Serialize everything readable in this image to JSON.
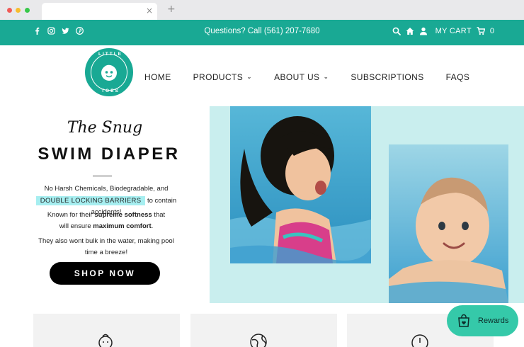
{
  "browser": {
    "new_tab_symbol": "+",
    "close_symbol": "×"
  },
  "topbar": {
    "social_icons": [
      "facebook-icon",
      "instagram-icon",
      "twitter-icon",
      "pinterest-icon"
    ],
    "phone": "Questions? Call (561) 207-7680",
    "cart_label": "MY CART",
    "cart_count": "0",
    "bg_color": "#19a994"
  },
  "logo": {
    "top_text": "LITTLE",
    "bottom_text": "TOES"
  },
  "nav": {
    "items": [
      {
        "label": "HOME",
        "has_dropdown": false
      },
      {
        "label": "PRODUCTS",
        "has_dropdown": true
      },
      {
        "label": "ABOUT US",
        "has_dropdown": true
      },
      {
        "label": "SUBSCRIPTIONS",
        "has_dropdown": false
      },
      {
        "label": "FAQS",
        "has_dropdown": false
      }
    ],
    "chevron": "⌄"
  },
  "hero": {
    "script_title": "The Snug",
    "title": "SWIM DIAPER",
    "line1": "No Harsh Chemicals, Biodegradable, and",
    "highlight": "DOUBLE LOCKING BARRIERS",
    "line2_after": " to contain accidents!",
    "line3_pre": "Known for their ",
    "line3_bold": "supreme softness",
    "line3_post": " that",
    "line4_pre": "will ensure ",
    "line4_bold": "maximum comfort",
    "line4_post": ".",
    "line5": "They also wont bulk in the water, making pool",
    "line6": "time a breeze!",
    "cta": "SHOP NOW",
    "panel_color": "#c9eeee"
  },
  "rewards": {
    "label": "Rewards",
    "color": "#35c9a9"
  }
}
